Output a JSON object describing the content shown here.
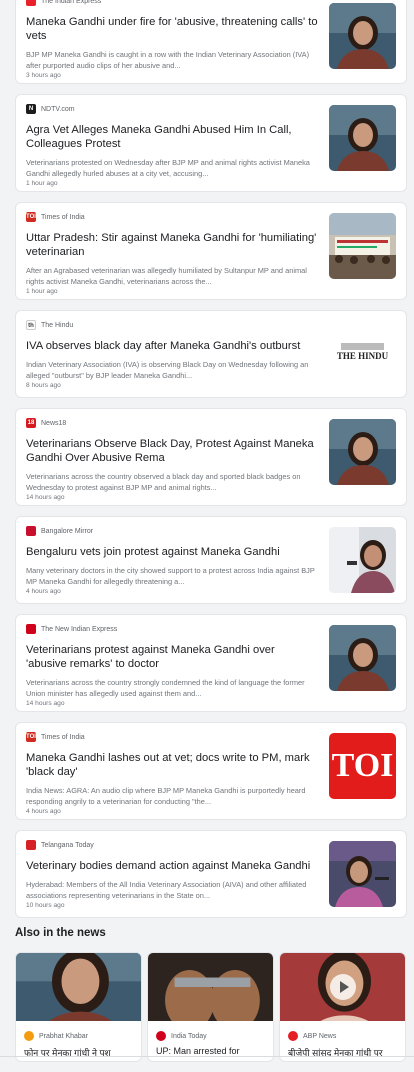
{
  "articles": [
    {
      "source": "The Indian Express",
      "title": "Maneka Gandhi under fire for 'abusive, threatening calls' to vets",
      "snippet": "BJP MP Maneka Gandhi is caught in a row with the Indian Veterinary Association (IVA) after purported audio clips of her abusive and...",
      "time": "3 hours ago",
      "logo_color": "#e8212b",
      "logo_text": "",
      "thumb": "woman-portrait"
    },
    {
      "source": "NDTV.com",
      "title": "Agra Vet Alleges Maneka Gandhi Abused Him In Call, Colleagues Protest",
      "snippet": "Veterinarians protested on Wednesday after BJP MP and animal rights activist Maneka Gandhi allegedly hurled abuses at a city vet, accusing...",
      "time": "1 hour ago",
      "logo_color": "#1c1c1c",
      "logo_text": "N",
      "thumb": "woman-portrait"
    },
    {
      "source": "Times of India",
      "title": "Uttar Pradesh: Stir against Maneka Gandhi for 'humiliating' veterinarian",
      "snippet": "After an Agrabased veterinarian was allegedly humiliated by Sultanpur MP and animal rights activist Maneka Gandhi, veterinarians across the...",
      "time": "1 hour ago",
      "logo_color": "#d32a1f",
      "logo_text": "TOI",
      "thumb": "protest-banner"
    },
    {
      "source": "The Hindu",
      "title": "IVA observes black day after Maneka Gandhi's outburst",
      "snippet": "Indian Veterinary Association (IVA) is observing Black Day on Wednesday following an alleged \"outburst\" by BJP leader Maneka Gandhi...",
      "time": "8 hours ago",
      "logo_color": "#ffffff",
      "logo_text": "th",
      "thumb": "the-hindu-logo",
      "thumb_text": "THE HINDU"
    },
    {
      "source": "News18",
      "title": "Veterinarians Observe Black Day, Protest Against Maneka Gandhi Over Abusive Rema",
      "snippet": "Veterinarians across the country observed a black day and sported black badges on Wednesday to protest against BJP MP and animal rights...",
      "time": "14 hours ago",
      "logo_color": "#d71920",
      "logo_text": "18",
      "thumb": "woman-portrait"
    },
    {
      "source": "Bangalore Mirror",
      "title": "Bengaluru vets join protest against Maneka Gandhi",
      "snippet": "Many veterinary doctors in the city showed support to a protest across India against BJP MP Maneka Gandhi for allegedly threatening a...",
      "time": "4 hours ago",
      "logo_color": "#c8102e",
      "logo_text": "",
      "thumb": "woman-mic"
    },
    {
      "source": "The New Indian Express",
      "title": "Veterinarians protest against Maneka Gandhi over 'abusive remarks' to doctor",
      "snippet": "Veterinarians across the country strongly condemned the kind of language the former Union minister has allegedly used against them and...",
      "time": "14 hours ago",
      "logo_color": "#d0021b",
      "logo_text": "",
      "thumb": "woman-portrait"
    },
    {
      "source": "Times of India",
      "title": "Maneka Gandhi lashes out at vet; docs write to PM, mark 'black day'",
      "snippet": "India News: AGRA: An audio clip where BJP MP Maneka Gandhi is purportedly heard responding angrily to a veterinarian for conducting \"the...",
      "time": "4 hours ago",
      "logo_color": "#d32a1f",
      "logo_text": "TOI",
      "thumb": "toi-logo",
      "thumb_text": "TOI"
    },
    {
      "source": "Telangana Today",
      "title": "Veterinary bodies demand action against Maneka Gandhi",
      "snippet": "Hyderabad: Members of the All India Veterinary Association (AIVA) and other affiliated associations representing veterinarians in the State on...",
      "time": "10 hours ago",
      "logo_color": "#d62027",
      "logo_text": "",
      "thumb": "woman-mic-purple"
    }
  ],
  "also_in_news": {
    "heading": "Also in the news",
    "items": [
      {
        "source": "Prabhat Khabar",
        "title": "फोन पर मेनका गांधी ने पश",
        "logo_color": "#f39c12",
        "thumb": "woman-portrait"
      },
      {
        "source": "India Today",
        "title": "UP: Man arrested for",
        "logo_color": "#d0021b",
        "thumb": "handcuffs"
      },
      {
        "source": "ABP News",
        "title": "बीजेपी सांसद मेनका गांधी पर",
        "logo_color": "#e31e24",
        "thumb": "woman-video"
      }
    ]
  }
}
